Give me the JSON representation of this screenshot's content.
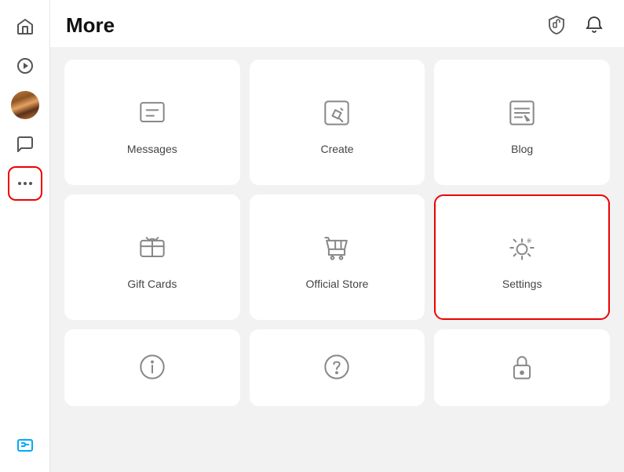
{
  "sidebar": {
    "items": [
      {
        "name": "home",
        "label": "Home"
      },
      {
        "name": "discover",
        "label": "Discover"
      },
      {
        "name": "avatar",
        "label": "Avatar"
      },
      {
        "name": "chat",
        "label": "Chat"
      },
      {
        "name": "more",
        "label": "More",
        "active": true
      }
    ],
    "bottom_items": [
      {
        "name": "robux",
        "label": "Robux"
      }
    ]
  },
  "header": {
    "title": "More",
    "icons": [
      {
        "name": "shield",
        "label": "Robux Shield"
      },
      {
        "name": "bell",
        "label": "Notifications"
      }
    ]
  },
  "grid": {
    "cards": [
      {
        "id": "messages",
        "label": "Messages",
        "icon": "messages",
        "highlighted": false
      },
      {
        "id": "create",
        "label": "Create",
        "icon": "create",
        "highlighted": false
      },
      {
        "id": "blog",
        "label": "Blog",
        "icon": "blog",
        "highlighted": false
      },
      {
        "id": "gift-cards",
        "label": "Gift Cards",
        "icon": "gift-cards",
        "highlighted": false
      },
      {
        "id": "official-store",
        "label": "Official Store",
        "icon": "official-store",
        "highlighted": false
      },
      {
        "id": "settings",
        "label": "Settings",
        "icon": "settings",
        "highlighted": true
      }
    ],
    "partial_cards": [
      {
        "id": "info",
        "label": "",
        "icon": "info"
      },
      {
        "id": "help",
        "label": "",
        "icon": "help"
      },
      {
        "id": "lock",
        "label": "",
        "icon": "lock"
      }
    ]
  }
}
